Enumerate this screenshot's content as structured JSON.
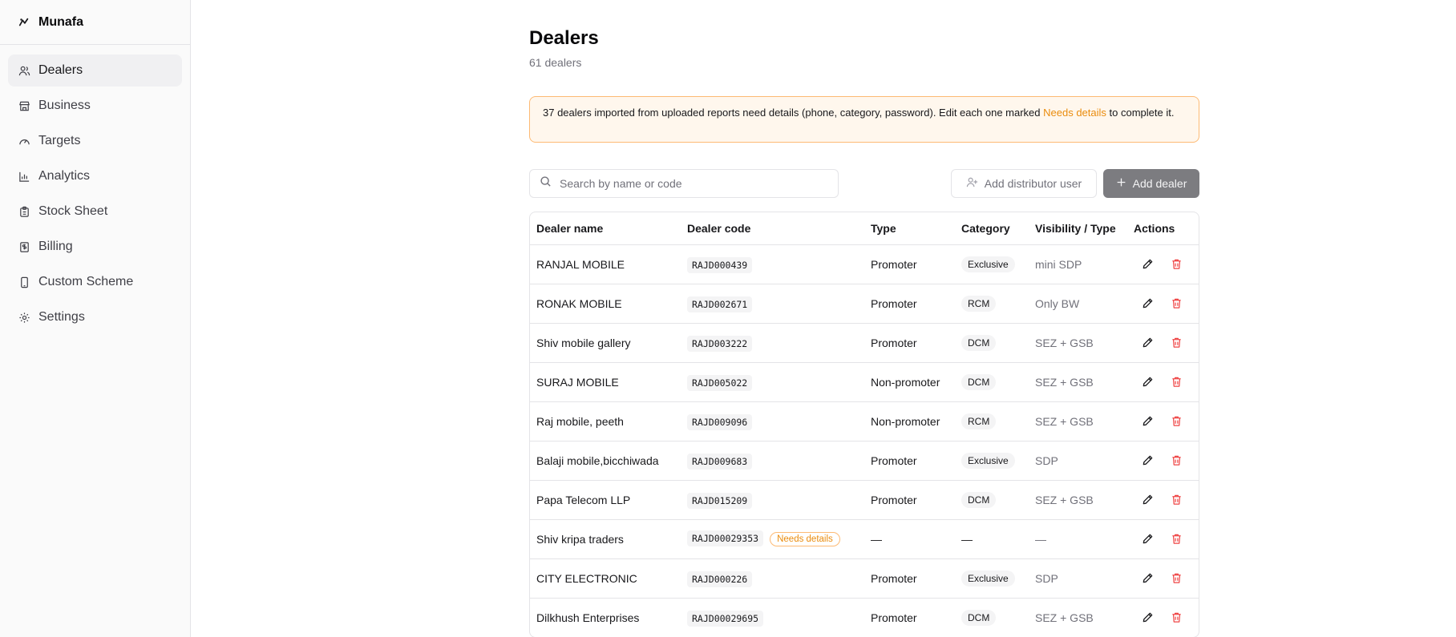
{
  "brand": {
    "name": "Munafa"
  },
  "sidebar": {
    "items": [
      {
        "label": "Dealers",
        "icon": "users-icon",
        "active": true
      },
      {
        "label": "Business",
        "icon": "store-icon"
      },
      {
        "label": "Targets",
        "icon": "gauge-icon"
      },
      {
        "label": "Analytics",
        "icon": "bar-chart-icon"
      },
      {
        "label": "Stock Sheet",
        "icon": "clipboard-icon"
      },
      {
        "label": "Billing",
        "icon": "receipt-icon"
      },
      {
        "label": "Custom Scheme",
        "icon": "phone-icon"
      },
      {
        "label": "Settings",
        "icon": "gear-icon"
      }
    ]
  },
  "page": {
    "title": "Dealers",
    "subtitle": "61 dealers"
  },
  "alert": {
    "text_before": "37 dealers imported from uploaded reports need details (phone, category, password). Edit each one marked ",
    "highlight": "Needs details",
    "text_after": " to complete it."
  },
  "toolbar": {
    "search_placeholder": "Search by name or code",
    "search_value": "",
    "add_distributor_label": "Add distributor user",
    "add_dealer_label": "Add dealer"
  },
  "table": {
    "headers": [
      "Dealer name",
      "Dealer code",
      "Type",
      "Category",
      "Visibility / Type",
      "Actions"
    ],
    "rows": [
      {
        "name": "RANJAL MOBILE",
        "code": "RAJD000439",
        "needs": "",
        "type": "Promoter",
        "category": "Exclusive",
        "visibility": "mini SDP"
      },
      {
        "name": "RONAK MOBILE",
        "code": "RAJD002671",
        "needs": "",
        "type": "Promoter",
        "category": "RCM",
        "visibility": "Only BW"
      },
      {
        "name": "Shiv mobile gallery",
        "code": "RAJD003222",
        "needs": "",
        "type": "Promoter",
        "category": "DCM",
        "visibility": "SEZ + GSB"
      },
      {
        "name": "SURAJ MOBILE",
        "code": "RAJD005022",
        "needs": "",
        "type": "Non-promoter",
        "category": "DCM",
        "visibility": "SEZ + GSB"
      },
      {
        "name": "Raj mobile, peeth",
        "code": "RAJD009096",
        "needs": "",
        "type": "Non-promoter",
        "category": "RCM",
        "visibility": "SEZ + GSB"
      },
      {
        "name": "Balaji mobile,bicchiwada",
        "code": "RAJD009683",
        "needs": "",
        "type": "Promoter",
        "category": "Exclusive",
        "visibility": "SDP"
      },
      {
        "name": "Papa Telecom LLP",
        "code": "RAJD015209",
        "needs": "",
        "type": "Promoter",
        "category": "DCM",
        "visibility": "SEZ + GSB"
      },
      {
        "name": "Shiv kripa traders",
        "code": "RAJD00029353",
        "needs": "Needs details",
        "type": "—",
        "category": "—",
        "visibility": "—"
      },
      {
        "name": "CITY ELECTRONIC",
        "code": "RAJD000226",
        "needs": "",
        "type": "Promoter",
        "category": "Exclusive",
        "visibility": "SDP"
      },
      {
        "name": "Dilkhush Enterprises",
        "code": "RAJD00029695",
        "needs": "",
        "type": "Promoter",
        "category": "DCM",
        "visibility": "SEZ + GSB"
      }
    ]
  },
  "colors": {
    "accent_orange": "#ea8c0e",
    "danger": "#ef4444",
    "primary_button": "#7c7c80"
  }
}
